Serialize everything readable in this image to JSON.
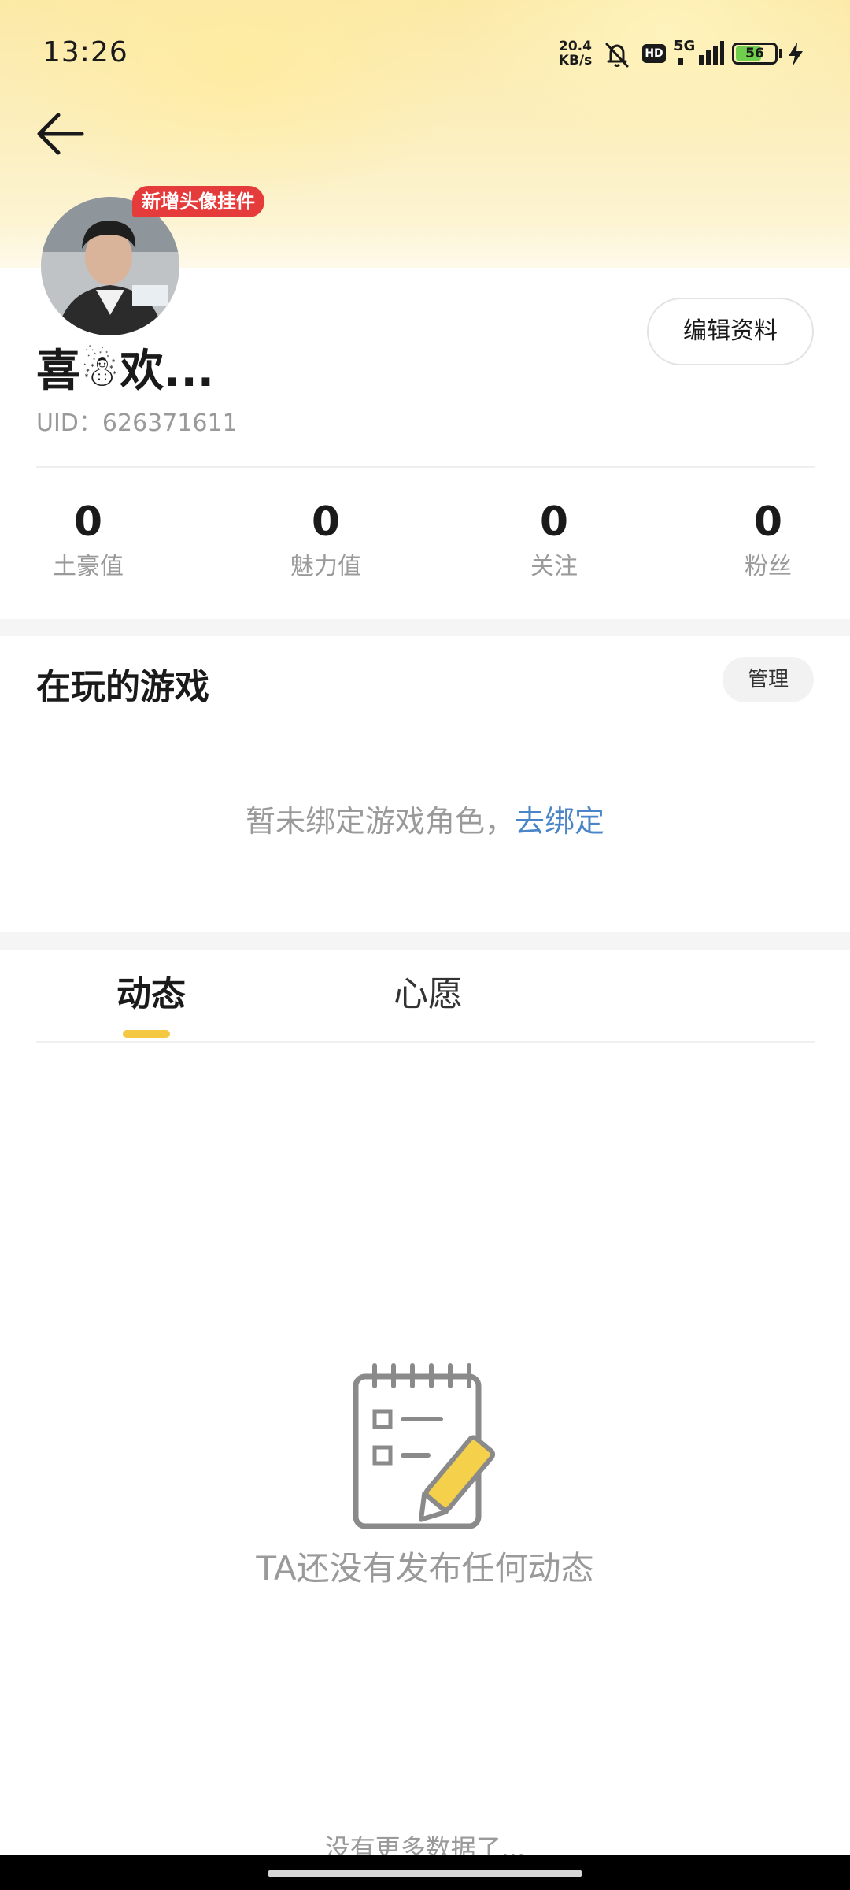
{
  "status_bar": {
    "time": "13:26",
    "net_speed_value": "20.4",
    "net_speed_unit": "KB/s",
    "hd_label": "HD",
    "network_label": "5G",
    "battery_level": "56",
    "icons": [
      "mute-icon",
      "hd-icon",
      "signal-icon",
      "battery-icon",
      "charging-bolt-icon"
    ]
  },
  "header": {
    "back_icon": "arrow-left-icon"
  },
  "profile": {
    "pendant_badge": "新增头像挂件",
    "nickname": "喜☃欢...",
    "uid": "UID：626371611",
    "edit_button": "编辑资料"
  },
  "stats": [
    {
      "value": "0",
      "label": "土豪值"
    },
    {
      "value": "0",
      "label": "魅力值"
    },
    {
      "value": "0",
      "label": "关注"
    },
    {
      "value": "0",
      "label": "粉丝"
    }
  ],
  "games": {
    "title": "在玩的游戏",
    "manage_button": "管理",
    "empty_text": "暂未绑定游戏角色，",
    "bind_link": "去绑定"
  },
  "tabs": [
    {
      "label": "动态",
      "active": true
    },
    {
      "label": "心愿",
      "active": false
    }
  ],
  "feed": {
    "empty_icon": "notepad-pencil-icon",
    "empty_text": "TA还没有发布任何动态",
    "no_more": "没有更多数据了..."
  },
  "colors": {
    "accent_yellow": "#f5c842",
    "link_blue": "#4a86c7",
    "badge_red": "#e63b3b",
    "battery_green": "#6fcf4d"
  }
}
